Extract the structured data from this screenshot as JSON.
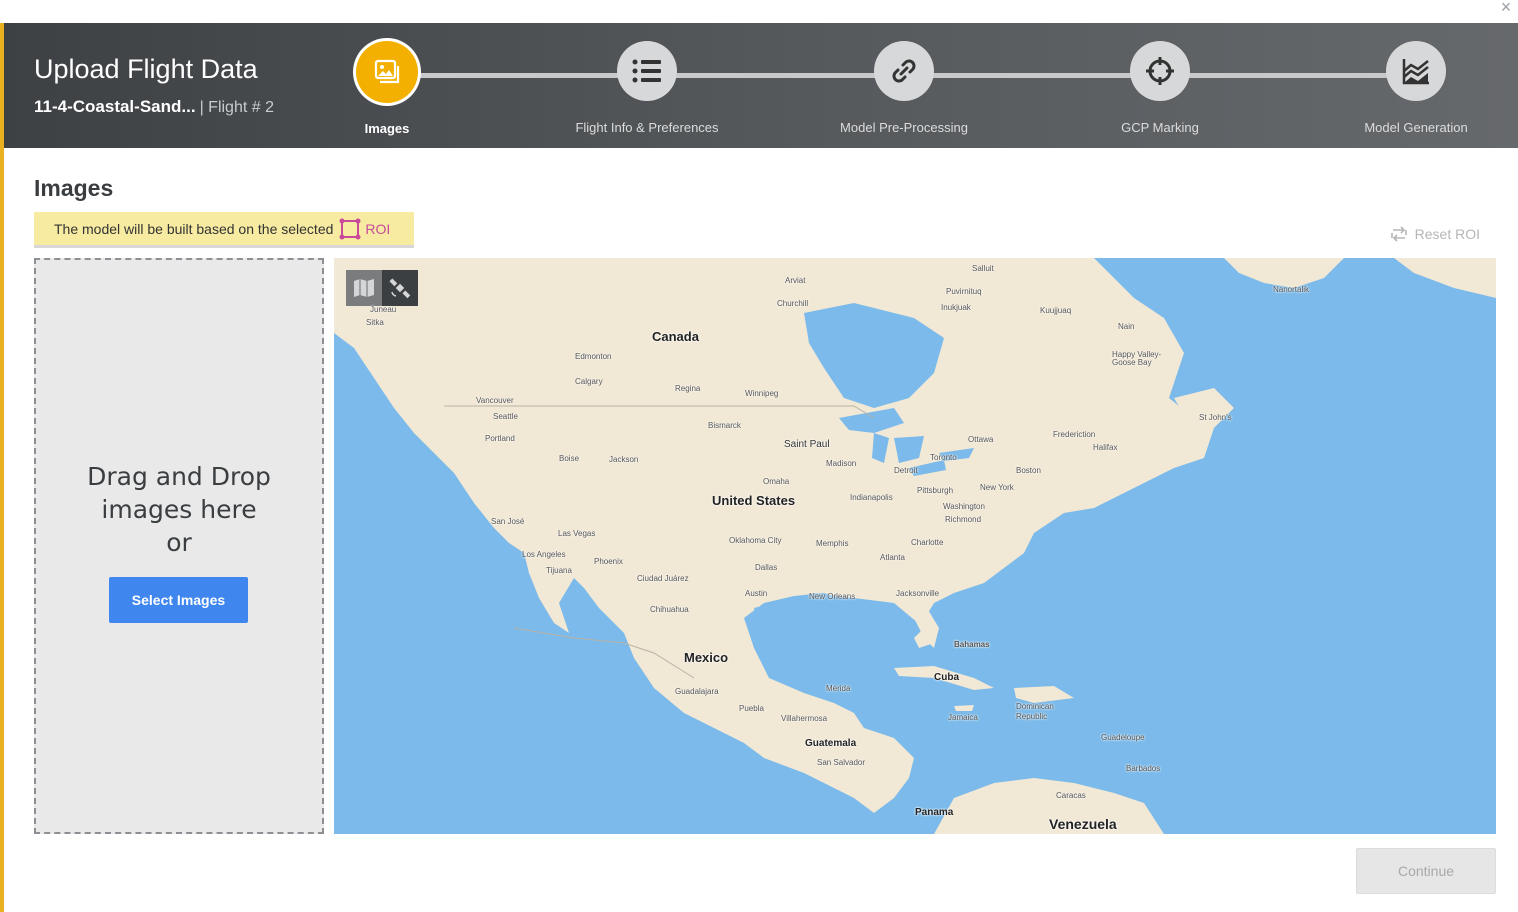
{
  "window": {
    "close_label": "×"
  },
  "header": {
    "title": "Upload Flight Data",
    "project_name": "11-4-Coastal-Sand...",
    "flight_label": "| Flight # 2",
    "accent_color": "#f3b000"
  },
  "steps": [
    {
      "label": "Images",
      "icon": "images-icon",
      "active": true
    },
    {
      "label": "Flight Info & Preferences",
      "icon": "list-icon",
      "active": false
    },
    {
      "label": "Model Pre-Processing",
      "icon": "link-icon",
      "active": false
    },
    {
      "label": "GCP Marking",
      "icon": "crosshair-icon",
      "active": false
    },
    {
      "label": "Model Generation",
      "icon": "layers-chart-icon",
      "active": false
    }
  ],
  "section": {
    "title": "Images"
  },
  "roi_banner": {
    "text": "The model will be built based on the selected",
    "link": "ROI",
    "color": "#f7eba2"
  },
  "reset_roi": {
    "label": "Reset ROI"
  },
  "dropzone": {
    "line1": "Drag and Drop",
    "line2": "images here",
    "line3": "or",
    "button": "Select Images",
    "button_color": "#3f86ee"
  },
  "map": {
    "toggle": [
      "map-icon",
      "satellite-icon"
    ],
    "countries": [
      "Canada",
      "United States",
      "Mexico",
      "Cuba",
      "Guatemala",
      "Venezuela",
      "Bahamas",
      "Panama"
    ],
    "cities": [
      "Edmonton",
      "Calgary",
      "Regina",
      "Winnipeg",
      "Vancouver",
      "Seattle",
      "Portland",
      "Boise",
      "Jackson",
      "Bismarck",
      "Saint Paul",
      "Madison",
      "Ottawa",
      "Toronto",
      "Detroit",
      "Boston",
      "New York",
      "Pittsburgh",
      "Washington",
      "Richmond",
      "Omaha",
      "Indianapolis",
      "San José",
      "Las Vegas",
      "Los Angeles",
      "Tijuana",
      "Phoenix",
      "Oklahoma City",
      "Memphis",
      "Charlotte",
      "Atlanta",
      "Dallas",
      "Ciudad Juárez",
      "Austin",
      "New Orleans",
      "Jacksonville",
      "Chihuahua",
      "Guadalajara",
      "Mérida",
      "Puebla",
      "Villahermosa",
      "San Salvador",
      "Jamaica",
      "Dominican Republic",
      "Guadeloupe",
      "Barbados",
      "Caracas",
      "Frederiction",
      "Halifax",
      "St John's",
      "Happy Valley-Goose Bay",
      "Churchill",
      "Nain",
      "Kuujjuaq",
      "Inukjuak",
      "Puvirnituq",
      "Salluit",
      "Arviat",
      "Nanortalik",
      "Juneau",
      "Sitka"
    ]
  },
  "footer": {
    "continue": "Continue"
  }
}
